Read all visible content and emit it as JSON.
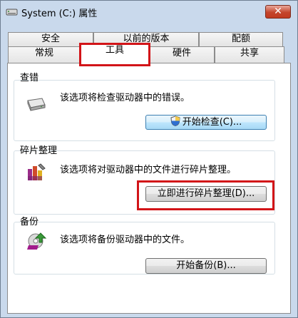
{
  "window": {
    "title": "System (C:) 属性",
    "close_label": "✕"
  },
  "tabs": {
    "row_back": [
      "安全",
      "以前的版本",
      "配额"
    ],
    "row_front": [
      "常规",
      "工具",
      "硬件",
      "共享"
    ],
    "active": "工具"
  },
  "groups": {
    "error_check": {
      "title": "查错",
      "description": "该选项将检查驱动器中的错误。",
      "button_label": "开始检查(C)..."
    },
    "defrag": {
      "title": "碎片整理",
      "description": "该选项将对驱动器中的文件进行碎片整理。",
      "button_label": "立即进行碎片整理(D)..."
    },
    "backup": {
      "title": "备份",
      "description": "该选项将备份驱动器中的文件。",
      "button_label": "开始备份(B)..."
    }
  },
  "colors": {
    "window_frame": "#c9d9ec",
    "close_button": "#c4452c",
    "annotation_red": "#d21418"
  },
  "icons": {
    "title": "drive-icon",
    "error_check": "hard-drive-icon",
    "defrag": "defrag-icon",
    "backup": "backup-icon",
    "button": "uac-shield-icon"
  }
}
